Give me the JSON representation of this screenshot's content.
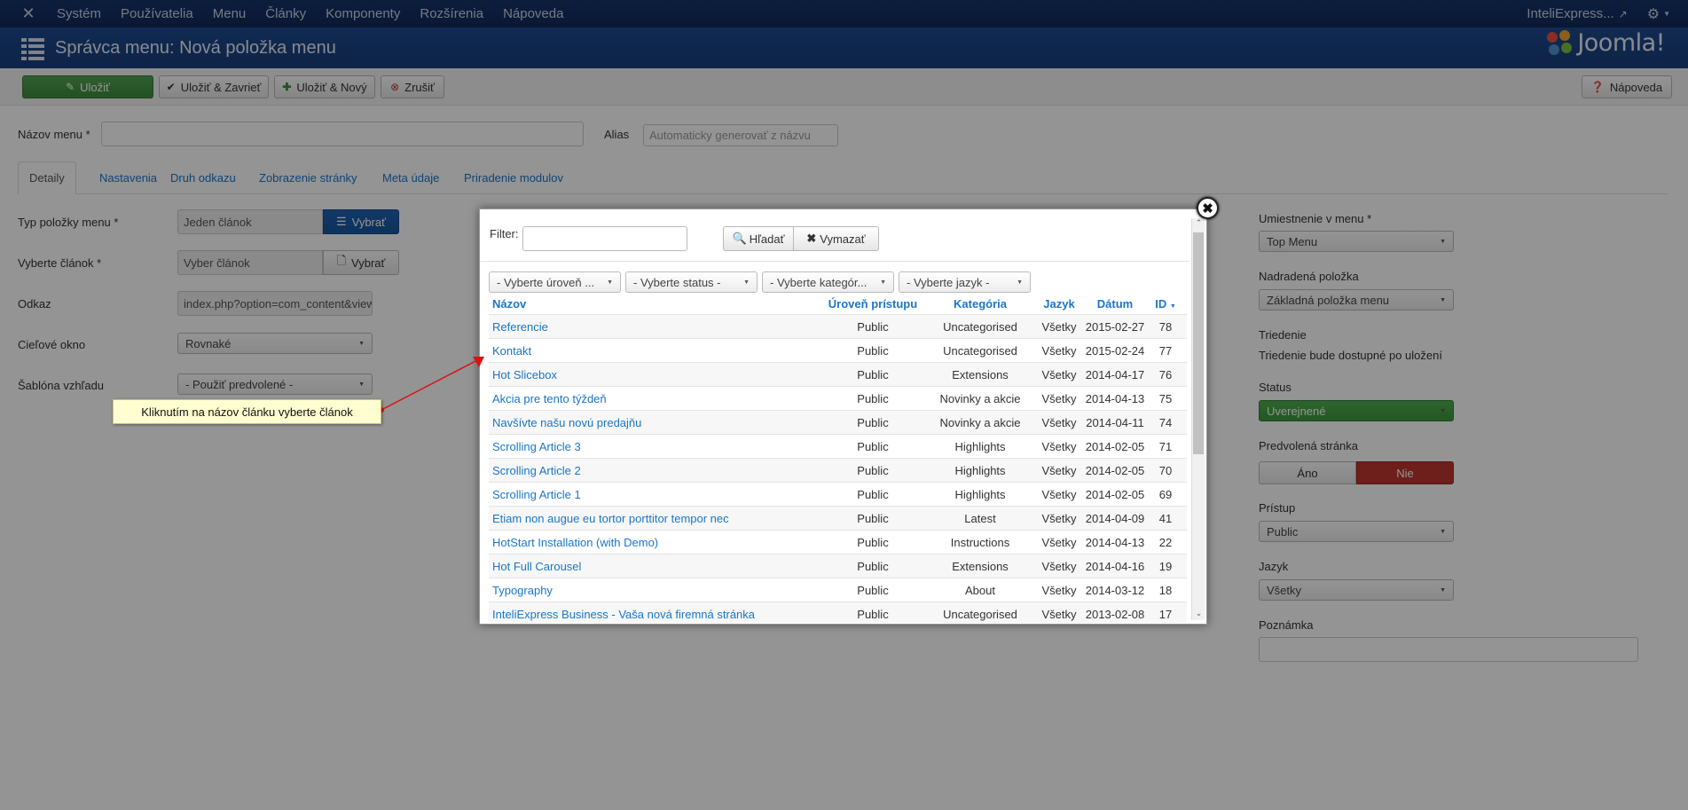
{
  "topnav": {
    "logo_icon": "joomla-icon",
    "items": [
      "Systém",
      "Používatelia",
      "Menu",
      "Články",
      "Komponenty",
      "Rozšírenia",
      "Nápoveda"
    ],
    "site_name": "InteliExpress...",
    "external_icon": "external-link-icon",
    "settings_icon": "gear-icon"
  },
  "header": {
    "title": "Správca menu: Nová položka menu",
    "brand": "Joomla!"
  },
  "toolbar": {
    "save": "Uložiť",
    "save_close": "Uložiť & Zavrieť",
    "save_new": "Uložiť & Nový",
    "cancel": "Zrušiť",
    "help": "Nápoveda"
  },
  "form": {
    "menu_title_label": "Názov menu *",
    "alias_label": "Alias",
    "alias_placeholder": "Automaticky generovať z názvu",
    "tabs": [
      "Detaily",
      "Nastavenia",
      "Druh odkazu",
      "Zobrazenie stránky",
      "Meta údaje",
      "Priradenie modulov"
    ],
    "item_type_label": "Typ položky menu *",
    "item_type_value": "Jeden článok",
    "select_btn": "Vybrať",
    "article_label": "Vyberte článok *",
    "article_value": "Vyber článok",
    "link_label": "Odkaz",
    "link_value": "index.php?option=com_content&view",
    "target_label": "Cieľové okno",
    "target_value": "Rovnaké",
    "template_label": "Šablóna vzhľadu",
    "template_value": "- Použiť predvolené -"
  },
  "right_panel": {
    "menu_location_label": "Umiestnenie v menu *",
    "menu_location_value": "Top Menu",
    "parent_label": "Nadradená položka",
    "parent_value": "Základná položka menu",
    "ordering_label": "Triedenie",
    "ordering_text": "Triedenie bude dostupné po uložení",
    "status_label": "Status",
    "status_value": "Uverejnené",
    "default_label": "Predvolená stránka",
    "yes": "Áno",
    "no": "Nie",
    "access_label": "Prístup",
    "access_value": "Public",
    "language_label": "Jazyk",
    "language_value": "Všetky",
    "note_label": "Poznámka"
  },
  "modal": {
    "filter_label": "Filter:",
    "search_btn": "Hľadať",
    "clear_btn": "Vymazať",
    "selects": [
      "- Vyberte úroveň ...",
      "- Vyberte status -",
      "- Vyberte kategór...",
      "- Vyberte jazyk -"
    ],
    "columns": {
      "name": "Názov",
      "access": "Úroveň prístupu",
      "category": "Kategória",
      "language": "Jazyk",
      "date": "Dátum",
      "id": "ID"
    },
    "sort_indicator": "▼",
    "rows": [
      {
        "name": "Referencie",
        "access": "Public",
        "category": "Uncategorised",
        "language": "Všetky",
        "date": "2015-02-27",
        "id": "78"
      },
      {
        "name": "Kontakt",
        "access": "Public",
        "category": "Uncategorised",
        "language": "Všetky",
        "date": "2015-02-24",
        "id": "77"
      },
      {
        "name": "Hot Slicebox",
        "access": "Public",
        "category": "Extensions",
        "language": "Všetky",
        "date": "2014-04-17",
        "id": "76"
      },
      {
        "name": "Akcia pre tento týždeň",
        "access": "Public",
        "category": "Novinky a akcie",
        "language": "Všetky",
        "date": "2014-04-13",
        "id": "75"
      },
      {
        "name": "Navšívte našu novú predajňu",
        "access": "Public",
        "category": "Novinky a akcie",
        "language": "Všetky",
        "date": "2014-04-11",
        "id": "74"
      },
      {
        "name": "Scrolling Article 3",
        "access": "Public",
        "category": "Highlights",
        "language": "Všetky",
        "date": "2014-02-05",
        "id": "71"
      },
      {
        "name": "Scrolling Article 2",
        "access": "Public",
        "category": "Highlights",
        "language": "Všetky",
        "date": "2014-02-05",
        "id": "70"
      },
      {
        "name": "Scrolling Article 1",
        "access": "Public",
        "category": "Highlights",
        "language": "Všetky",
        "date": "2014-02-05",
        "id": "69"
      },
      {
        "name": "Etiam non augue eu tortor porttitor tempor nec",
        "access": "Public",
        "category": "Latest",
        "language": "Všetky",
        "date": "2014-04-09",
        "id": "41"
      },
      {
        "name": "HotStart Installation (with Demo)",
        "access": "Public",
        "category": "Instructions",
        "language": "Všetky",
        "date": "2014-04-13",
        "id": "22"
      },
      {
        "name": "Hot Full Carousel",
        "access": "Public",
        "category": "Extensions",
        "language": "Všetky",
        "date": "2014-04-16",
        "id": "19"
      },
      {
        "name": "Typography",
        "access": "Public",
        "category": "About",
        "language": "Všetky",
        "date": "2014-03-12",
        "id": "18"
      },
      {
        "name": "InteliExpress Business - Vaša nová firemná stránka",
        "access": "Public",
        "category": "Uncategorised",
        "language": "Všetky",
        "date": "2013-02-08",
        "id": "17"
      }
    ]
  },
  "tooltip": "Kliknutím na názov článku vyberte článok",
  "colors": {
    "nav": "#11295a",
    "header": "#1c4483",
    "green": "#46a546",
    "red": "#bd362f",
    "link": "#1a76c9"
  }
}
